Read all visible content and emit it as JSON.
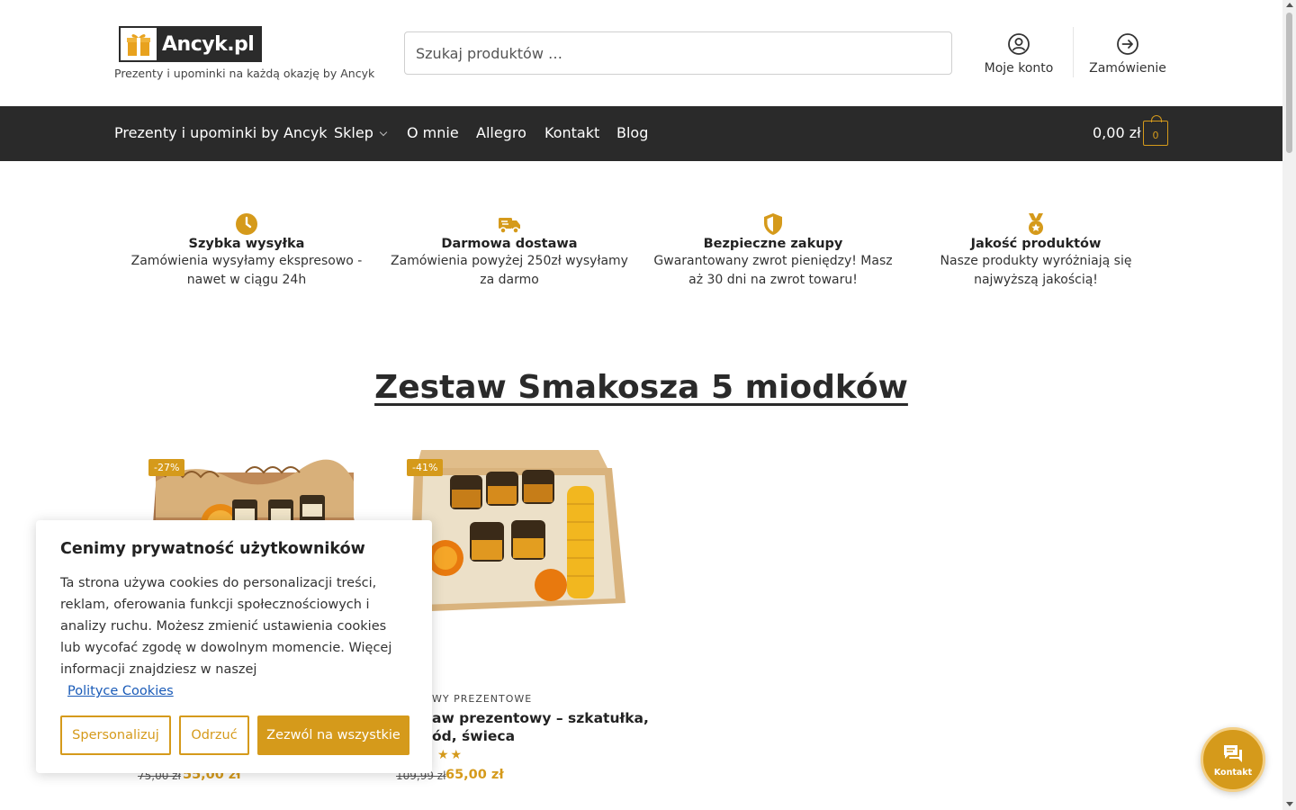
{
  "header": {
    "logo_text": "Ancyk.pl",
    "tagline": "Prezenty i upominki na każdą okazję by Ancyk",
    "search_placeholder": "Szukaj produktów …",
    "account_label": "Moje konto",
    "order_label": "Zamówienie"
  },
  "nav": {
    "items": [
      {
        "label": "Prezenty i upominki by Ancyk"
      },
      {
        "label": "Sklep"
      },
      {
        "label": "O mnie"
      },
      {
        "label": "Allegro"
      },
      {
        "label": "Kontakt"
      },
      {
        "label": "Blog"
      }
    ],
    "cart_total": "0,00 zł",
    "cart_count": "0"
  },
  "features": [
    {
      "icon": "clock-icon",
      "title": "Szybka wysyłka",
      "desc": "Zamówienia wysyłamy ekspresowo - nawet w ciągu 24h"
    },
    {
      "icon": "truck-icon",
      "title": "Darmowa dostawa",
      "desc": "Zamówienia powyżej 250zł wysyłamy za darmo"
    },
    {
      "icon": "shield-icon",
      "title": "Bezpieczne zakupy",
      "desc": "Gwarantowany zwrot pieniędzy! Masz aż 30 dni na zwrot towaru!"
    },
    {
      "icon": "medal-icon",
      "title": "Jakość produktów",
      "desc": "Nasze produkty wyróżniają się najwyższą jakością!"
    }
  ],
  "section_title": "Zestaw Smakosza 5 miodków",
  "products": [
    {
      "badge": "-27%",
      "category": "",
      "name": "",
      "old_price": "75,00 zł",
      "new_price": "55,00 zł"
    },
    {
      "badge": "-41%",
      "category": "WY PREZENTOWE",
      "name": "aw prezentowy – szkatułka, ód, świeca",
      "old_price": "109,99 zł",
      "new_price": "65,00 zł",
      "stars": "★★"
    }
  ],
  "cookie": {
    "title": "Cenimy prywatność użytkowników",
    "text": "Ta strona używa cookies do personalizacji treści, reklam, oferowania funkcji społecznościowych i analizy ruchu. Możesz zmienić ustawienia cookies lub wycofać zgodę w dowolnym momencie. Więcej informacji znajdziesz w naszej",
    "link": "Polityce Cookies",
    "btn_customize": "Spersonalizuj",
    "btn_reject": "Odrzuć",
    "btn_accept": "Zezwól na wszystkie"
  },
  "chat": {
    "label": "Kontakt"
  },
  "colors": {
    "accent": "#d59a1b",
    "nav_bg": "#2a2a2a",
    "link": "#1a5bb8"
  }
}
